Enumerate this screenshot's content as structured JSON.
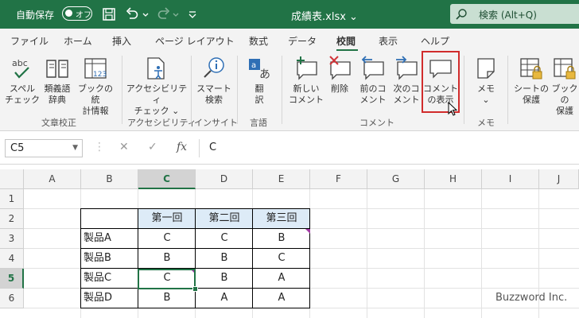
{
  "titlebar": {
    "autosave_label": "自動保存",
    "autosave_state": "オフ",
    "filename": "成績表.xlsx",
    "search_placeholder": "検索 (Alt+Q)",
    "bg_color": "#217346"
  },
  "tabs": [
    "ファイル",
    "ホーム",
    "挿入",
    "ページ レイアウト",
    "数式",
    "データ",
    "校閲",
    "表示",
    "ヘルプ"
  ],
  "active_tab": "校閲",
  "ribbon": {
    "groups": {
      "proofing": "文章校正",
      "accessibility": "アクセシビリティ",
      "insights": "インサイト",
      "language": "言語",
      "comments": "コメント",
      "notes": "メモ"
    },
    "buttons": {
      "spelling": [
        "スペル",
        "チェック"
      ],
      "thesaurus": [
        "類義語",
        "辞典"
      ],
      "workbook_stats": [
        "ブックの統",
        "計情報"
      ],
      "check_accessibility": [
        "アクセシビリティ",
        "チェック ⌄"
      ],
      "smart_lookup": [
        "スマート",
        "検索"
      ],
      "translate": [
        "翻",
        "訳"
      ],
      "new_comment": [
        "新しい",
        "コメント"
      ],
      "delete": [
        "削除",
        ""
      ],
      "prev_comment": [
        "前のコ",
        "メント"
      ],
      "next_comment": [
        "次のコ",
        "メント"
      ],
      "show_comments": [
        "コメント",
        "の表示"
      ],
      "notes": [
        "メモ",
        "⌄"
      ],
      "protect_sheet": [
        "シートの",
        "保護"
      ],
      "protect_workbook": [
        "ブックの",
        "保護"
      ]
    },
    "spell_icon_text": "abc",
    "stats_icon_text": "123"
  },
  "formula_bar": {
    "name_box": "C5",
    "content": "C"
  },
  "columns": [
    "A",
    "B",
    "C",
    "D",
    "E",
    "F",
    "G",
    "H",
    "I",
    "J"
  ],
  "rows": [
    "1",
    "2",
    "3",
    "4",
    "5",
    "6"
  ],
  "table": {
    "headers": [
      "第一回",
      "第二回",
      "第三回"
    ],
    "rows": [
      {
        "name": "製品A",
        "values": [
          "C",
          "C",
          "B"
        ]
      },
      {
        "name": "製品B",
        "values": [
          "B",
          "B",
          "C"
        ]
      },
      {
        "name": "製品C",
        "values": [
          "C",
          "B",
          "A"
        ]
      },
      {
        "name": "製品D",
        "values": [
          "B",
          "A",
          "A"
        ]
      }
    ]
  },
  "selected_cell": "C5",
  "comment_marker_color": "#a23aa5",
  "watermark": "Buzzword Inc."
}
